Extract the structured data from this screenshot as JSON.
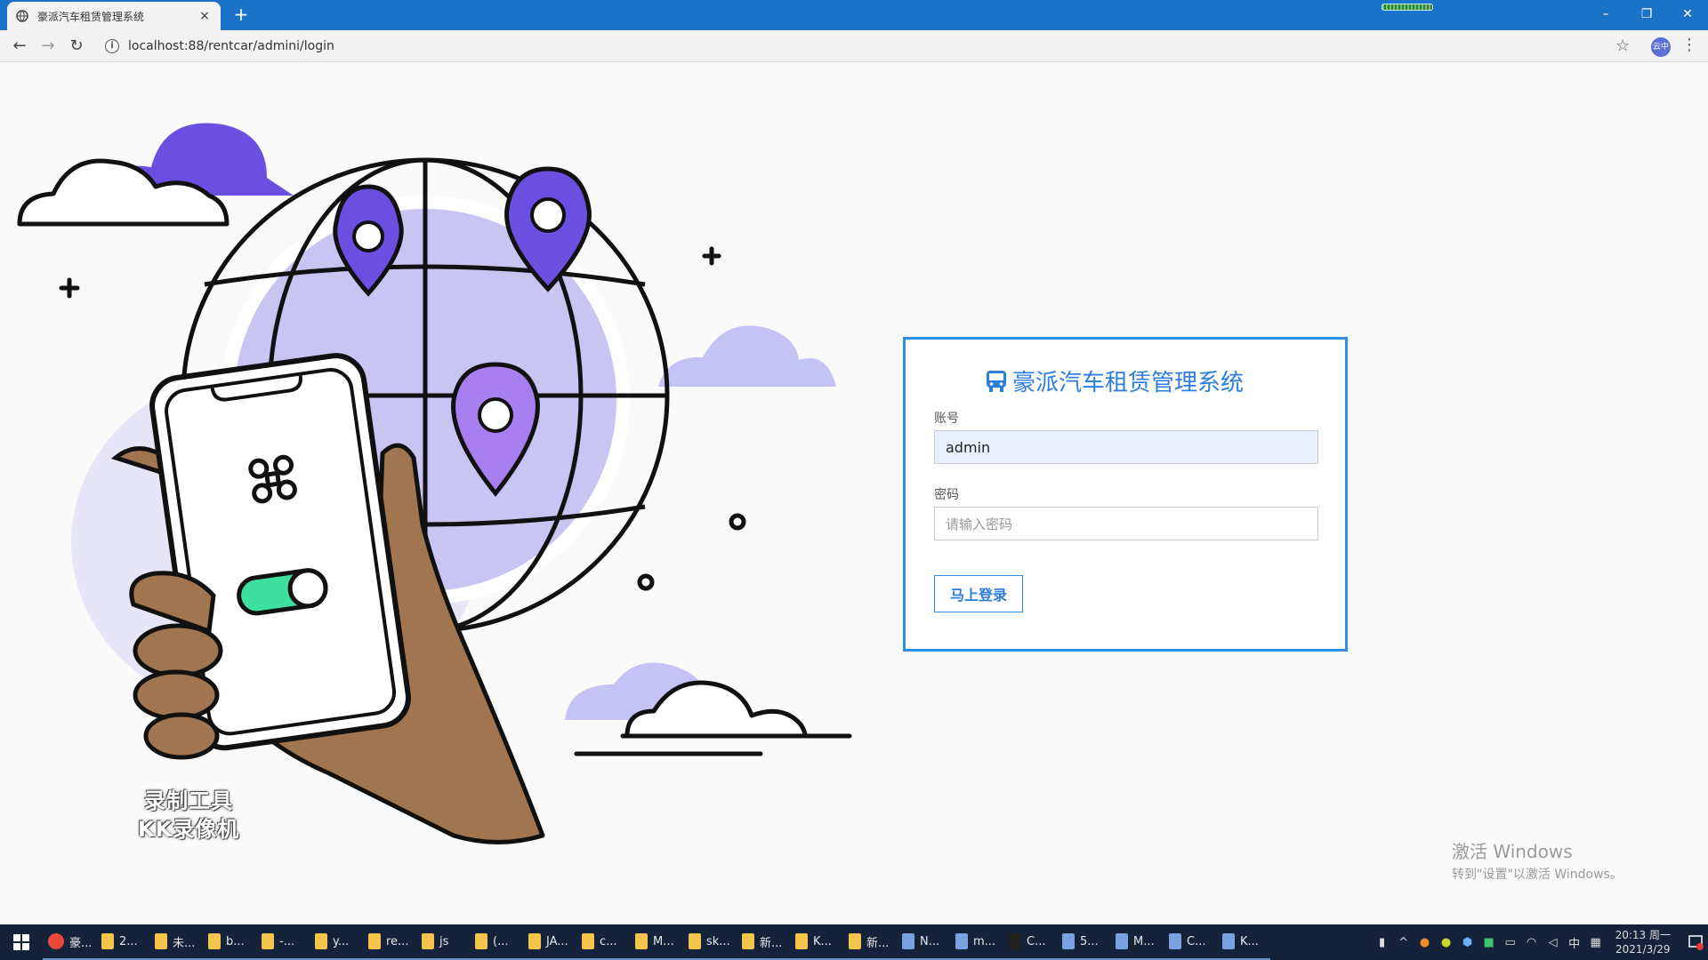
{
  "browser": {
    "tab_title": "豪派汽车租赁管理系统",
    "tab_close": "×",
    "new_tab": "+",
    "url": "localhost:88/rentcar/admini/login",
    "profile_label": "云中",
    "window_controls": [
      "–",
      "❐",
      "✕"
    ]
  },
  "login": {
    "title": "豪派汽车租赁管理系统",
    "account_label": "账号",
    "account_value": "admin",
    "password_label": "密码",
    "password_placeholder": "请输入密码",
    "submit_label": "马上登录"
  },
  "overlays": {
    "watermark_line1": "录制工具",
    "watermark_line2": "KK录像机",
    "activate_title": "激活 Windows",
    "activate_sub": "转到\"设置\"以激活 Windows。"
  },
  "taskbar": {
    "items": [
      {
        "label": "豪...",
        "icon": "chrome-icon"
      },
      {
        "label": "2...",
        "icon": "folder-icon"
      },
      {
        "label": "未...",
        "icon": "folder-icon"
      },
      {
        "label": "b...",
        "icon": "folder-icon"
      },
      {
        "label": "-...",
        "icon": "folder-icon"
      },
      {
        "label": "y...",
        "icon": "folder-icon"
      },
      {
        "label": "re...",
        "icon": "folder-icon"
      },
      {
        "label": "js",
        "icon": "folder-icon"
      },
      {
        "label": "(...",
        "icon": "folder-icon"
      },
      {
        "label": "JA...",
        "icon": "folder-icon"
      },
      {
        "label": "c...",
        "icon": "folder-icon"
      },
      {
        "label": "M...",
        "icon": "folder-icon"
      },
      {
        "label": "sk...",
        "icon": "folder-icon"
      },
      {
        "label": "新...",
        "icon": "folder-icon"
      },
      {
        "label": "K...",
        "icon": "folder-icon"
      },
      {
        "label": "新...",
        "icon": "folder-icon"
      },
      {
        "label": "N...",
        "icon": "app-icon"
      },
      {
        "label": "m...",
        "icon": "app-icon"
      },
      {
        "label": "C...",
        "icon": "terminal-icon"
      },
      {
        "label": "5...",
        "icon": "app-icon"
      },
      {
        "label": "M...",
        "icon": "app-icon"
      },
      {
        "label": "C...",
        "icon": "app-icon"
      },
      {
        "label": "K...",
        "icon": "app-icon"
      }
    ],
    "ime": "中",
    "time": "20:13 周一",
    "date": "2021/3/29",
    "notif_count": "4"
  },
  "colors": {
    "titlebar": "#1a73c9",
    "accent": "#2b7de0",
    "card_border": "#2e8fe6",
    "illustration_purple": "#6a4fe0",
    "illustration_lavender": "#c5c3f5",
    "hand_brown": "#a07550"
  }
}
